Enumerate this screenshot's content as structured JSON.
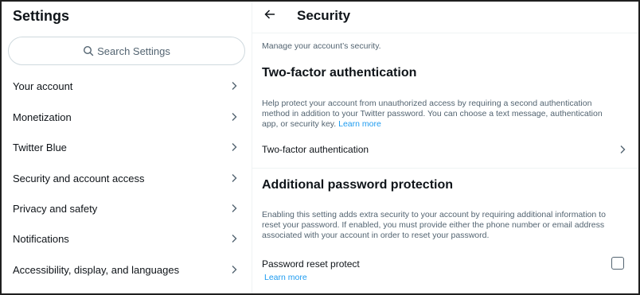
{
  "sidebar": {
    "title": "Settings",
    "search_placeholder": "Search Settings",
    "items": [
      {
        "label": "Your account"
      },
      {
        "label": "Monetization"
      },
      {
        "label": "Twitter Blue"
      },
      {
        "label": "Security and account access"
      },
      {
        "label": "Privacy and safety"
      },
      {
        "label": "Notifications"
      },
      {
        "label": "Accessibility, display, and languages"
      }
    ]
  },
  "main": {
    "title": "Security",
    "description": "Manage your account’s security.",
    "two_factor": {
      "heading": "Two-factor authentication",
      "body": "Help protect your account from unauthorized access by requiring a second authentication method in addition to your Twitter password. You can choose a text message, authentication app, or security key.",
      "learn_more": "Learn more",
      "row_label": "Two-factor authentication"
    },
    "password_protection": {
      "heading": "Additional password protection",
      "body": "Enabling this setting adds extra security to your account by requiring additional information to reset your password. If enabled, you must provide either the phone number or email address associated with your account in order to reset your password.",
      "row_label": "Password reset protect",
      "learn_more": "Learn more",
      "checked": false
    }
  },
  "colors": {
    "accent": "#1d9bf0",
    "text": "#0f1419",
    "muted": "#536471",
    "border": "#eff3f4"
  },
  "icons": {
    "search": "search-icon",
    "chevron": "chevron-right-icon",
    "back": "arrow-left-icon"
  }
}
